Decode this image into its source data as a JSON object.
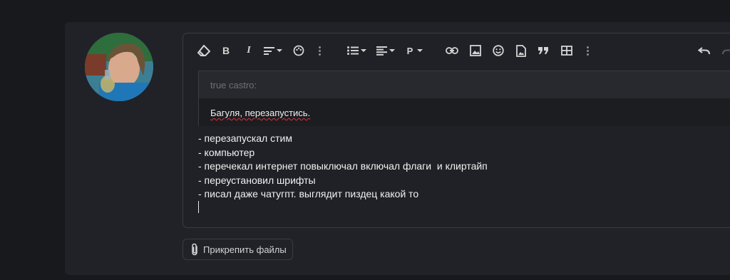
{
  "toolbar": {
    "icons": [
      "eraser-icon",
      "bold-icon",
      "italic-icon",
      "align-icon",
      "palette-icon",
      "more-icon",
      "list-icon",
      "indent-icon",
      "paragraph-icon",
      "link-icon",
      "image-icon",
      "emoji-icon",
      "file-icon",
      "quote-icon",
      "table-icon",
      "more-icon",
      "undo-icon",
      "redo-icon"
    ]
  },
  "quote": {
    "author": "true castro:",
    "text": "Багуля, перезапустись."
  },
  "message": {
    "lines": [
      "- перезапускал стим",
      "- компьютер",
      "- перечекал интернет повыключал включал флаги  и клиртайп",
      "- переустановил шрифты",
      "- писал даже чатугпт. выглядит пиздец какой то"
    ]
  },
  "attach": {
    "label": "Прикрепить файлы"
  },
  "colors": {
    "background": "#18191d",
    "panel": "#202227",
    "editor": "#1f2126",
    "spellcheck": "#dd3333"
  }
}
